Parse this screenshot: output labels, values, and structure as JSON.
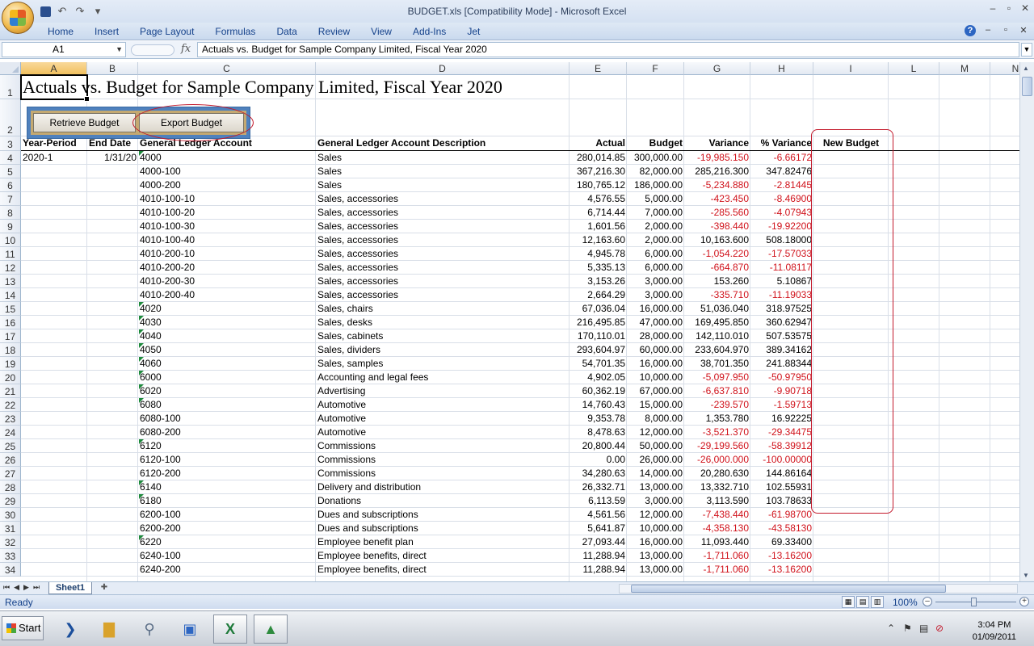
{
  "window": {
    "title": "BUDGET.xls  [Compatibility Mode] - Microsoft Excel"
  },
  "ribbon": {
    "tabs": [
      "Home",
      "Insert",
      "Page Layout",
      "Formulas",
      "Data",
      "Review",
      "View",
      "Add-Ins",
      "Jet"
    ]
  },
  "formula_bar": {
    "name_box": "A1",
    "fx_label": "fx",
    "content": "Actuals vs. Budget for Sample Company Limited, Fiscal Year 2020"
  },
  "columns": [
    "A",
    "B",
    "C",
    "D",
    "E",
    "F",
    "G",
    "H",
    "I",
    "L",
    "M",
    "N"
  ],
  "row_numbers": [
    "1",
    "2",
    "3",
    "4",
    "5",
    "6",
    "7",
    "8",
    "9",
    "10",
    "11",
    "12",
    "13",
    "14",
    "15",
    "16",
    "17",
    "18",
    "19",
    "20",
    "21",
    "22",
    "23",
    "24",
    "25",
    "26",
    "27",
    "28",
    "29",
    "30",
    "31",
    "32",
    "33",
    "34"
  ],
  "sheet": {
    "title": "Actuals vs. Budget for Sample Company Limited, Fiscal Year 2020",
    "buttons": {
      "retrieve": "Retrieve Budget",
      "export": "Export Budget"
    },
    "headers": [
      "Year-Period",
      "End Date",
      "General Ledger Account",
      "General Ledger Account Description",
      "Actual",
      "Budget",
      "Variance",
      "% Variance",
      "New Budget"
    ],
    "rows": [
      [
        "2020-1",
        "1/31/20",
        "4000",
        "Sales",
        "280,014.85",
        "300,000.00",
        "-19,985.150",
        "-6.66172"
      ],
      [
        "",
        "",
        "4000-100",
        "Sales",
        "367,216.30",
        "82,000.00",
        "285,216.300",
        "347.82476"
      ],
      [
        "",
        "",
        "4000-200",
        "Sales",
        "180,765.12",
        "186,000.00",
        "-5,234.880",
        "-2.81445"
      ],
      [
        "",
        "",
        "4010-100-10",
        "Sales, accessories",
        "4,576.55",
        "5,000.00",
        "-423.450",
        "-8.46900"
      ],
      [
        "",
        "",
        "4010-100-20",
        "Sales, accessories",
        "6,714.44",
        "7,000.00",
        "-285.560",
        "-4.07943"
      ],
      [
        "",
        "",
        "4010-100-30",
        "Sales, accessories",
        "1,601.56",
        "2,000.00",
        "-398.440",
        "-19.92200"
      ],
      [
        "",
        "",
        "4010-100-40",
        "Sales, accessories",
        "12,163.60",
        "2,000.00",
        "10,163.600",
        "508.18000"
      ],
      [
        "",
        "",
        "4010-200-10",
        "Sales, accessories",
        "4,945.78",
        "6,000.00",
        "-1,054.220",
        "-17.57033"
      ],
      [
        "",
        "",
        "4010-200-20",
        "Sales, accessories",
        "5,335.13",
        "6,000.00",
        "-664.870",
        "-11.08117"
      ],
      [
        "",
        "",
        "4010-200-30",
        "Sales, accessories",
        "3,153.26",
        "3,000.00",
        "153.260",
        "5.10867"
      ],
      [
        "",
        "",
        "4010-200-40",
        "Sales, accessories",
        "2,664.29",
        "3,000.00",
        "-335.710",
        "-11.19033"
      ],
      [
        "",
        "",
        "4020",
        "Sales, chairs",
        "67,036.04",
        "16,000.00",
        "51,036.040",
        "318.97525"
      ],
      [
        "",
        "",
        "4030",
        "Sales, desks",
        "216,495.85",
        "47,000.00",
        "169,495.850",
        "360.62947"
      ],
      [
        "",
        "",
        "4040",
        "Sales, cabinets",
        "170,110.01",
        "28,000.00",
        "142,110.010",
        "507.53575"
      ],
      [
        "",
        "",
        "4050",
        "Sales, dividers",
        "293,604.97",
        "60,000.00",
        "233,604.970",
        "389.34162"
      ],
      [
        "",
        "",
        "4060",
        "Sales, samples",
        "54,701.35",
        "16,000.00",
        "38,701.350",
        "241.88344"
      ],
      [
        "",
        "",
        "6000",
        "Accounting and legal fees",
        "4,902.05",
        "10,000.00",
        "-5,097.950",
        "-50.97950"
      ],
      [
        "",
        "",
        "6020",
        "Advertising",
        "60,362.19",
        "67,000.00",
        "-6,637.810",
        "-9.90718"
      ],
      [
        "",
        "",
        "6080",
        "Automotive",
        "14,760.43",
        "15,000.00",
        "-239.570",
        "-1.59713"
      ],
      [
        "",
        "",
        "6080-100",
        "Automotive",
        "9,353.78",
        "8,000.00",
        "1,353.780",
        "16.92225"
      ],
      [
        "",
        "",
        "6080-200",
        "Automotive",
        "8,478.63",
        "12,000.00",
        "-3,521.370",
        "-29.34475"
      ],
      [
        "",
        "",
        "6120",
        "Commissions",
        "20,800.44",
        "50,000.00",
        "-29,199.560",
        "-58.39912"
      ],
      [
        "",
        "",
        "6120-100",
        "Commissions",
        "0.00",
        "26,000.00",
        "-26,000.000",
        "-100.00000"
      ],
      [
        "",
        "",
        "6120-200",
        "Commissions",
        "34,280.63",
        "14,000.00",
        "20,280.630",
        "144.86164"
      ],
      [
        "",
        "",
        "6140",
        "Delivery and distribution",
        "26,332.71",
        "13,000.00",
        "13,332.710",
        "102.55931"
      ],
      [
        "",
        "",
        "6180",
        "Donations",
        "6,113.59",
        "3,000.00",
        "3,113.590",
        "103.78633"
      ],
      [
        "",
        "",
        "6200-100",
        "Dues and subscriptions",
        "4,561.56",
        "12,000.00",
        "-7,438.440",
        "-61.98700"
      ],
      [
        "",
        "",
        "6200-200",
        "Dues and subscriptions",
        "5,641.87",
        "10,000.00",
        "-4,358.130",
        "-43.58130"
      ],
      [
        "",
        "",
        "6220",
        "Employee benefit plan",
        "27,093.44",
        "16,000.00",
        "11,093.440",
        "69.33400"
      ],
      [
        "",
        "",
        "6240-100",
        "Employee benefits, direct",
        "11,288.94",
        "13,000.00",
        "-1,711.060",
        "-13.16200"
      ],
      [
        "",
        "",
        "6240-200",
        "Employee benefits, direct",
        "11,288.94",
        "13,000.00",
        "-1,711.060",
        "-13.16200"
      ]
    ]
  },
  "sheet_tabs": [
    "Sheet1"
  ],
  "status": {
    "text": "Ready",
    "zoom": "100%"
  },
  "taskbar": {
    "start": "Start",
    "time": "3:04 PM",
    "date": "01/09/2011"
  },
  "colors": {
    "negative": "#d0121b",
    "annotation": "#c3192b",
    "panel_border": "#4f81bd",
    "panel_fill": "#c4a971"
  }
}
